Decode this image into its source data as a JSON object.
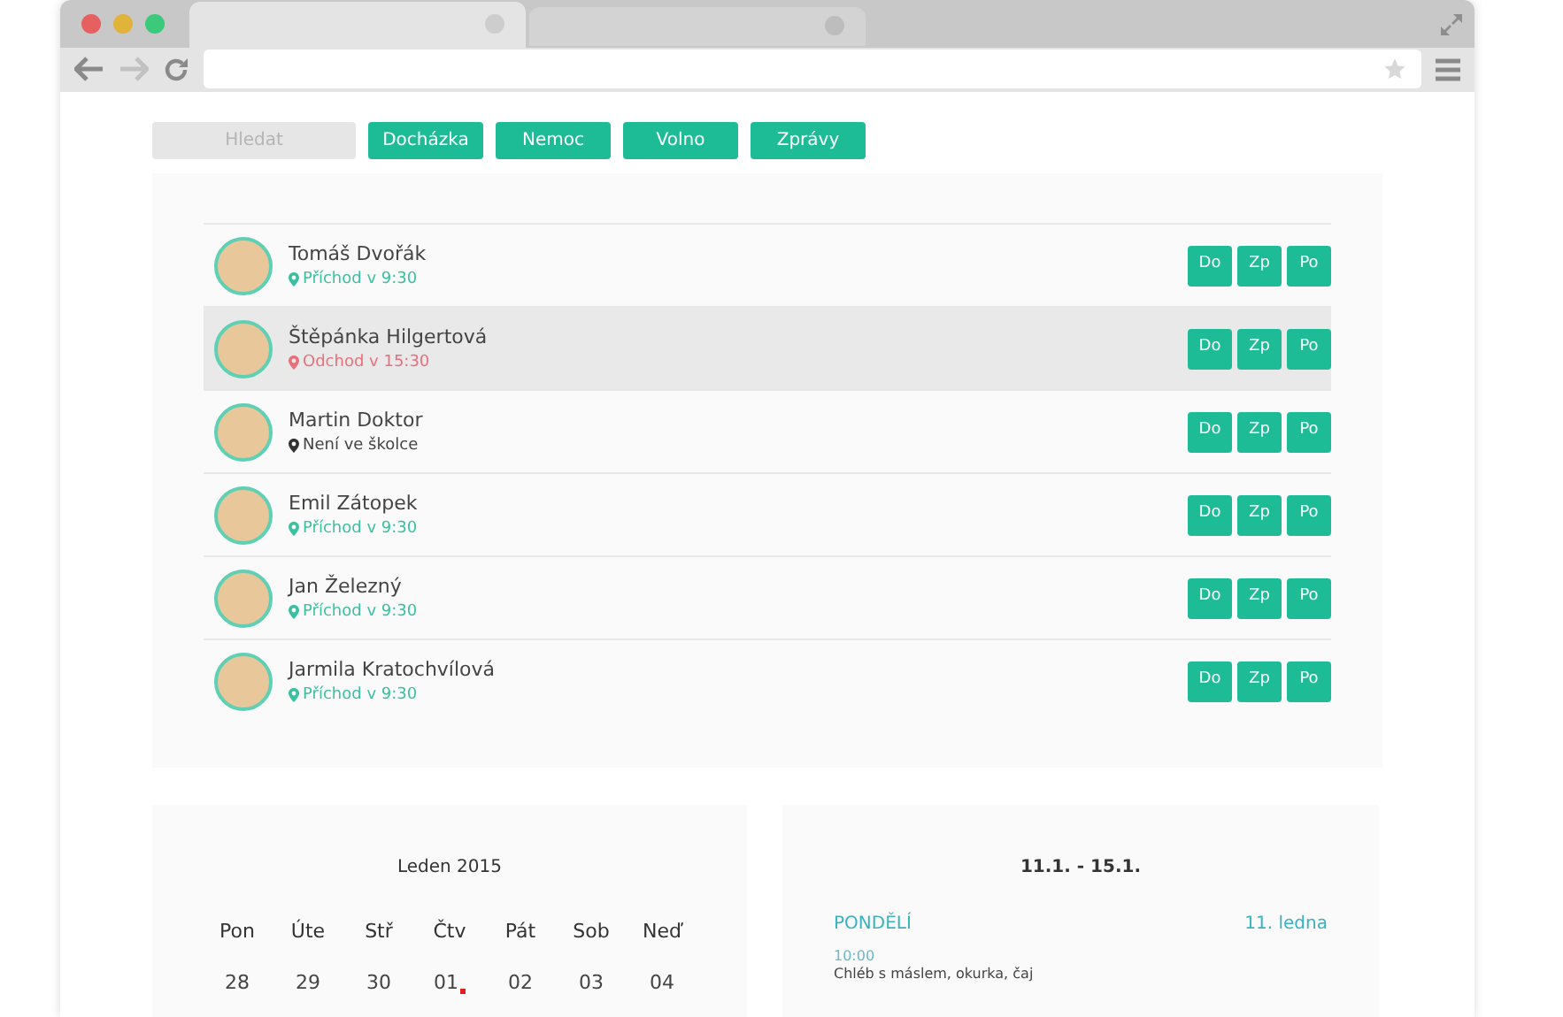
{
  "browser": {
    "tabs": [
      {
        "selected": true
      },
      {
        "selected": false
      }
    ]
  },
  "toolbar": {
    "search": {
      "placeholder": "Hledat"
    },
    "buttons": [
      "Docházka",
      "Nemoc",
      "Volno",
      "Zprávy"
    ]
  },
  "children": [
    {
      "name": "Tomáš Dvořák",
      "status": "Příchod v 9:30",
      "kind": "in",
      "selected": false,
      "actions": [
        "Do",
        "Zp",
        "Po"
      ]
    },
    {
      "name": "Štěpánka Hilgertová",
      "status": "Odchod v 15:30",
      "kind": "out",
      "selected": true,
      "actions": [
        "Do",
        "Zp",
        "Po"
      ]
    },
    {
      "name": "Martin Doktor",
      "status": "Není ve školce",
      "kind": "absent",
      "selected": false,
      "actions": [
        "Do",
        "Zp",
        "Po"
      ]
    },
    {
      "name": "Emil Zátopek",
      "status": "Příchod v 9:30",
      "kind": "in",
      "selected": false,
      "actions": [
        "Do",
        "Zp",
        "Po"
      ]
    },
    {
      "name": "Jan Železný",
      "status": "Příchod v 9:30",
      "kind": "in",
      "selected": false,
      "actions": [
        "Do",
        "Zp",
        "Po"
      ]
    },
    {
      "name": "Jarmila Kratochvílová",
      "status": "Příchod v 9:30",
      "kind": "in",
      "selected": false,
      "actions": [
        "Do",
        "Zp",
        "Po"
      ]
    }
  ],
  "calendar": {
    "title": "Leden 2015",
    "weekdays": [
      "Pon",
      "Úte",
      "Stř",
      "Čtv",
      "Pát",
      "Sob",
      "Neď"
    ],
    "days": [
      {
        "label": "28",
        "today": false
      },
      {
        "label": "29",
        "today": false
      },
      {
        "label": "30",
        "today": false
      },
      {
        "label": "01",
        "today": true
      },
      {
        "label": "02",
        "today": false
      },
      {
        "label": "03",
        "today": false
      },
      {
        "label": "04",
        "today": false
      }
    ]
  },
  "menu": {
    "title": "11.1. - 15.1.",
    "day": "PONDĚLÍ",
    "date": "11. ledna",
    "time": "10:00",
    "meal": "Chléb s máslem, okurka, čaj"
  }
}
